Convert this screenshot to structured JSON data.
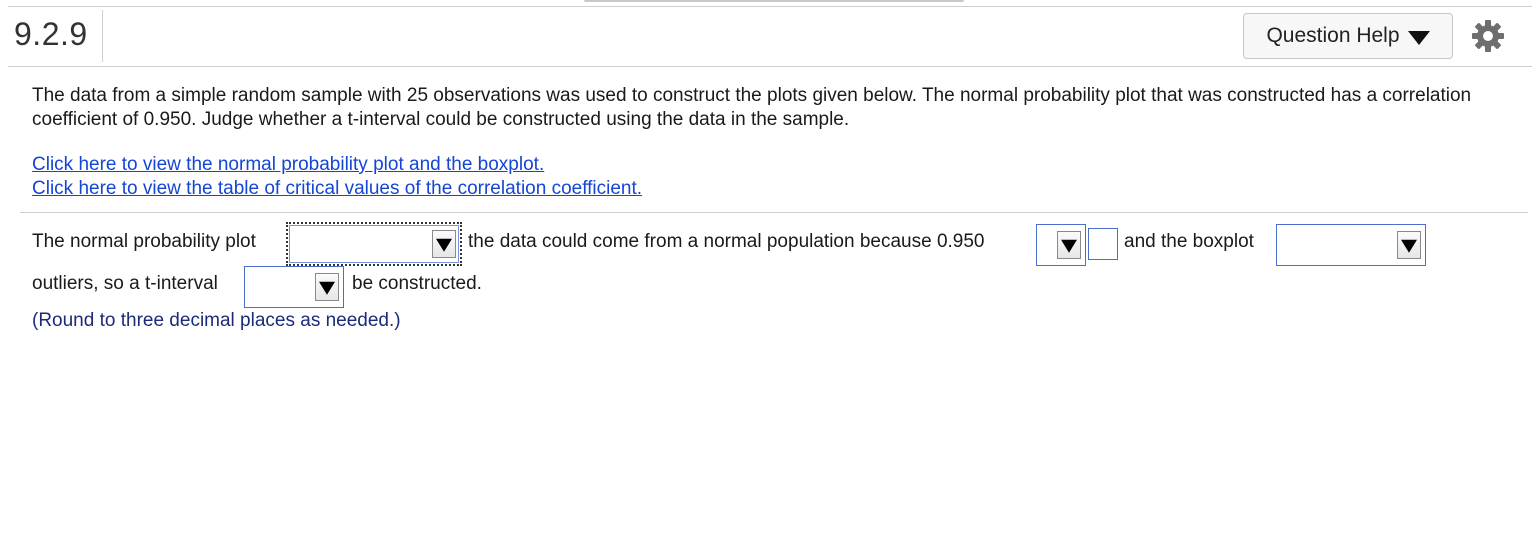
{
  "header": {
    "question_number": "9.2.9",
    "help_button_label": "Question Help"
  },
  "main": {
    "prompt": "The data from a simple random sample with 25 observations was used to construct the plots given below. The normal probability plot that was constructed has a correlation coefficient of 0.950. Judge whether a t-interval could be constructed using the data in the sample.",
    "links": [
      "Click here to view the normal probability plot and the boxplot.",
      "Click here to view the table of critical values of the correlation coefficient."
    ],
    "answer": {
      "text1": "The normal probability plot",
      "text2": "the data could come from a normal population because 0.950",
      "text3": "and the boxplot",
      "text4": "outliers, so a t-interval",
      "text5": "be constructed.",
      "dropdown1_value": "",
      "dropdown2_value": "",
      "critical_value_input": "",
      "dropdown3_value": "",
      "dropdown4_value": ""
    },
    "note": "(Round to three decimal places as needed.)"
  },
  "icons": [
    "dropdown-arrow-icon",
    "gear-icon"
  ]
}
